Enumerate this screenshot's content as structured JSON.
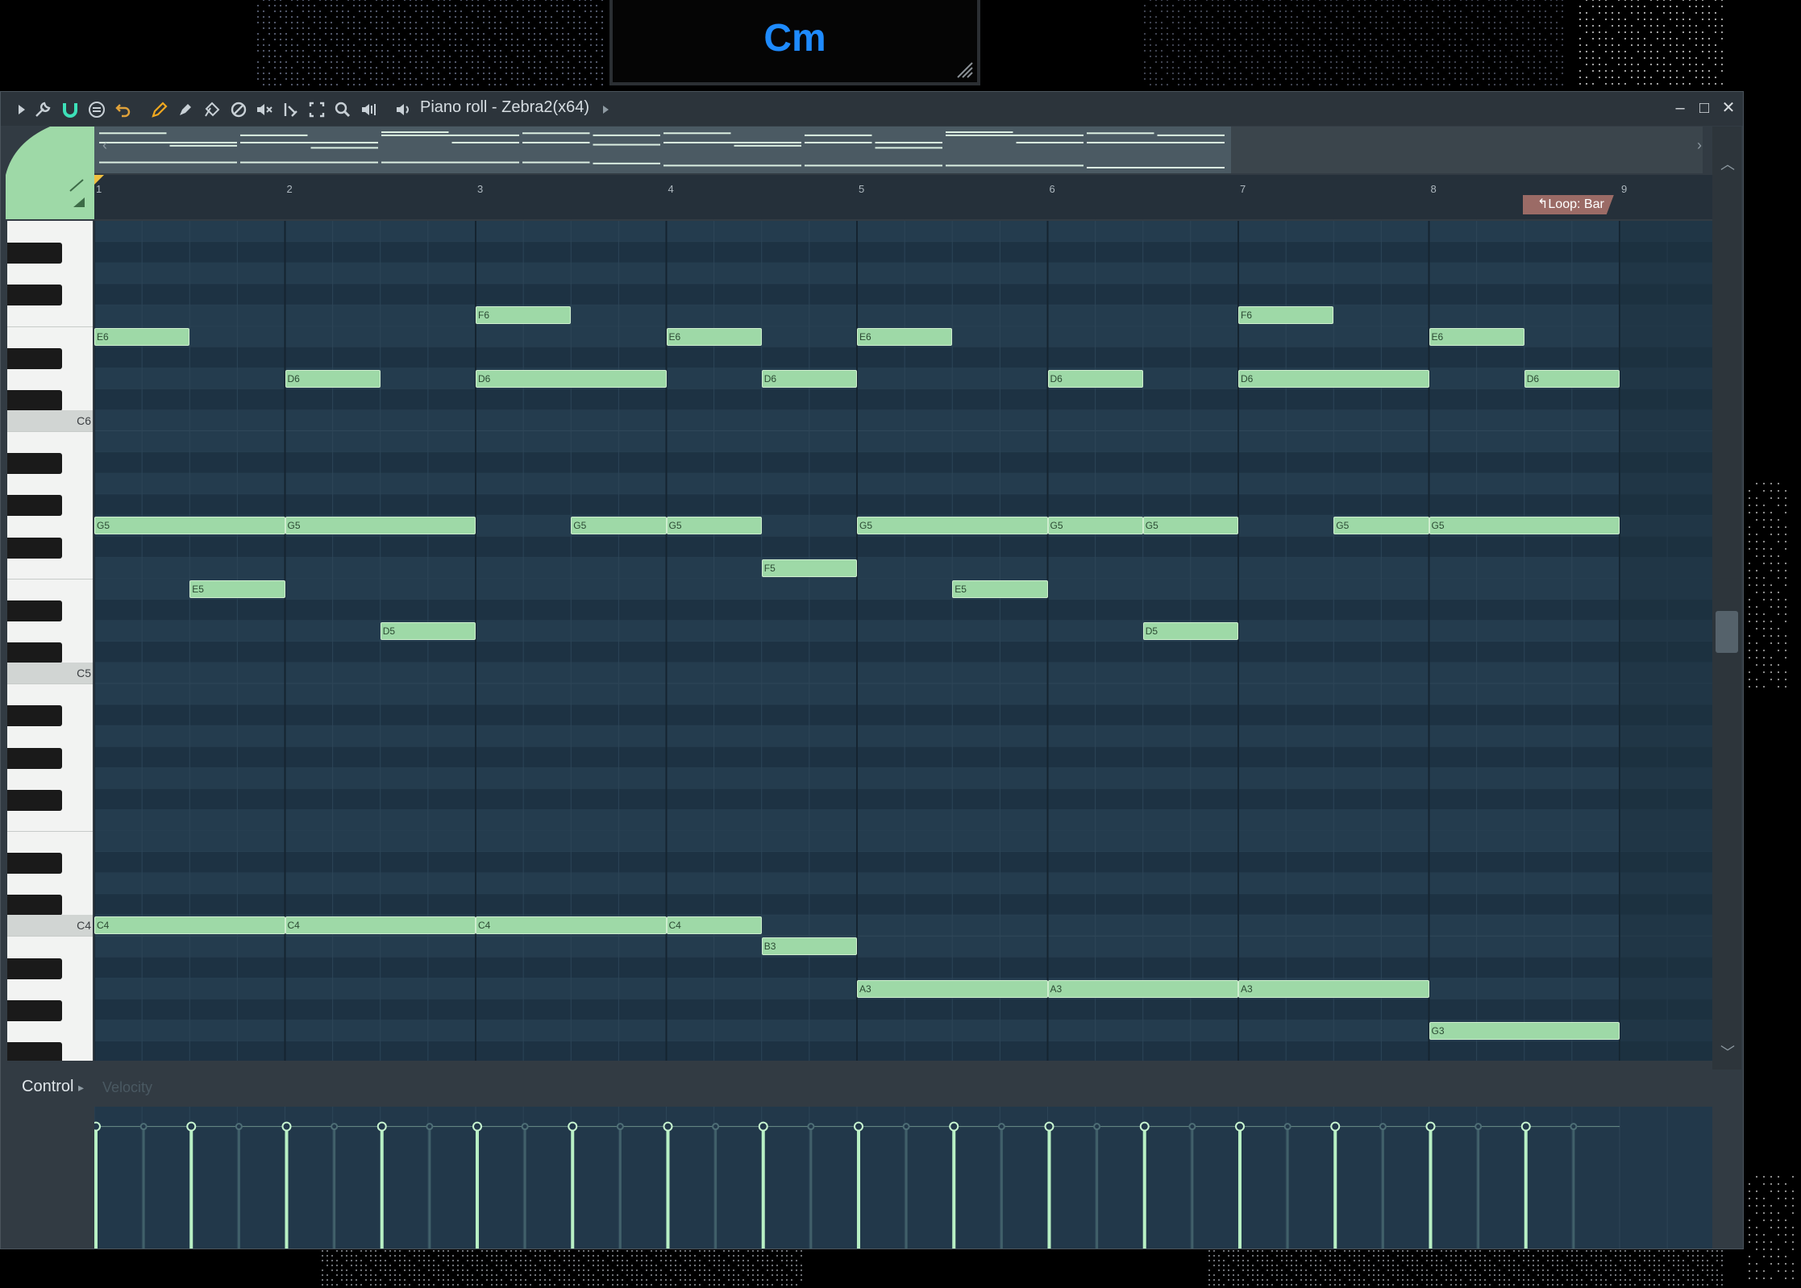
{
  "chord_display": {
    "name": "Cm"
  },
  "window": {
    "title": "Piano roll - Zebra2(x64)",
    "controls": {
      "minimize": "–",
      "maximize": "□",
      "close": "✕"
    }
  },
  "toolbar": {
    "icons": [
      "play-arrow-icon",
      "wrench-icon",
      "magnet-icon",
      "snap-icon",
      "undo-icon",
      "pencil-icon",
      "paint-icon",
      "erase-icon",
      "delete-icon",
      "mute-icon",
      "slice-icon",
      "select-icon",
      "zoom-icon",
      "playback-icon",
      "speaker-icon"
    ]
  },
  "ruler": {
    "bars": [
      "1",
      "2",
      "3",
      "4",
      "5",
      "6",
      "7",
      "8",
      "9"
    ],
    "loop_label": "Loop: Bar"
  },
  "keyboard": {
    "c_labels": [
      "C6",
      "C5",
      "C4"
    ]
  },
  "notes": [
    {
      "pitch": "F6",
      "start": 3.0,
      "len": 0.5
    },
    {
      "pitch": "F6",
      "start": 7.0,
      "len": 0.5
    },
    {
      "pitch": "E6",
      "start": 1.0,
      "len": 0.5
    },
    {
      "pitch": "E6",
      "start": 4.0,
      "len": 0.5
    },
    {
      "pitch": "E6",
      "start": 5.0,
      "len": 0.5
    },
    {
      "pitch": "E6",
      "start": 8.0,
      "len": 0.5
    },
    {
      "pitch": "D6",
      "start": 2.0,
      "len": 0.5
    },
    {
      "pitch": "D6",
      "start": 3.0,
      "len": 1.0
    },
    {
      "pitch": "D6",
      "start": 4.5,
      "len": 0.5
    },
    {
      "pitch": "D6",
      "start": 6.0,
      "len": 0.5
    },
    {
      "pitch": "D6",
      "start": 7.0,
      "len": 1.0
    },
    {
      "pitch": "D6",
      "start": 8.5,
      "len": 0.5
    },
    {
      "pitch": "G5",
      "start": 1.0,
      "len": 1.0
    },
    {
      "pitch": "G5",
      "start": 2.0,
      "len": 1.0
    },
    {
      "pitch": "G5",
      "start": 3.5,
      "len": 0.5
    },
    {
      "pitch": "G5",
      "start": 4.0,
      "len": 0.5
    },
    {
      "pitch": "G5",
      "start": 5.0,
      "len": 1.0
    },
    {
      "pitch": "G5",
      "start": 6.0,
      "len": 0.5
    },
    {
      "pitch": "G5",
      "start": 6.5,
      "len": 0.5
    },
    {
      "pitch": "G5",
      "start": 7.5,
      "len": 0.5
    },
    {
      "pitch": "G5",
      "start": 8.0,
      "len": 1.0
    },
    {
      "pitch": "F5",
      "start": 4.5,
      "len": 0.5
    },
    {
      "pitch": "E5",
      "start": 1.5,
      "len": 0.5
    },
    {
      "pitch": "E5",
      "start": 5.5,
      "len": 0.5
    },
    {
      "pitch": "D5",
      "start": 2.5,
      "len": 0.5
    },
    {
      "pitch": "D5",
      "start": 6.5,
      "len": 0.5
    },
    {
      "pitch": "C4",
      "start": 1.0,
      "len": 1.0
    },
    {
      "pitch": "C4",
      "start": 2.0,
      "len": 1.0
    },
    {
      "pitch": "C4",
      "start": 3.0,
      "len": 1.0
    },
    {
      "pitch": "C4",
      "start": 4.0,
      "len": 0.5
    },
    {
      "pitch": "B3",
      "start": 4.5,
      "len": 0.5
    },
    {
      "pitch": "A3",
      "start": 5.0,
      "len": 1.0
    },
    {
      "pitch": "A3",
      "start": 6.0,
      "len": 1.0
    },
    {
      "pitch": "A3",
      "start": 7.0,
      "len": 1.0
    },
    {
      "pitch": "G3",
      "start": 8.0,
      "len": 1.0
    }
  ],
  "control": {
    "label": "Control",
    "target": "Velocity",
    "velocity_level": 0.86
  },
  "colors": {
    "note_fill": "#9ed9a7",
    "grid_bg": "#22384a",
    "chord_text": "#1e8bff",
    "loop_tag": "#9b6b66"
  }
}
